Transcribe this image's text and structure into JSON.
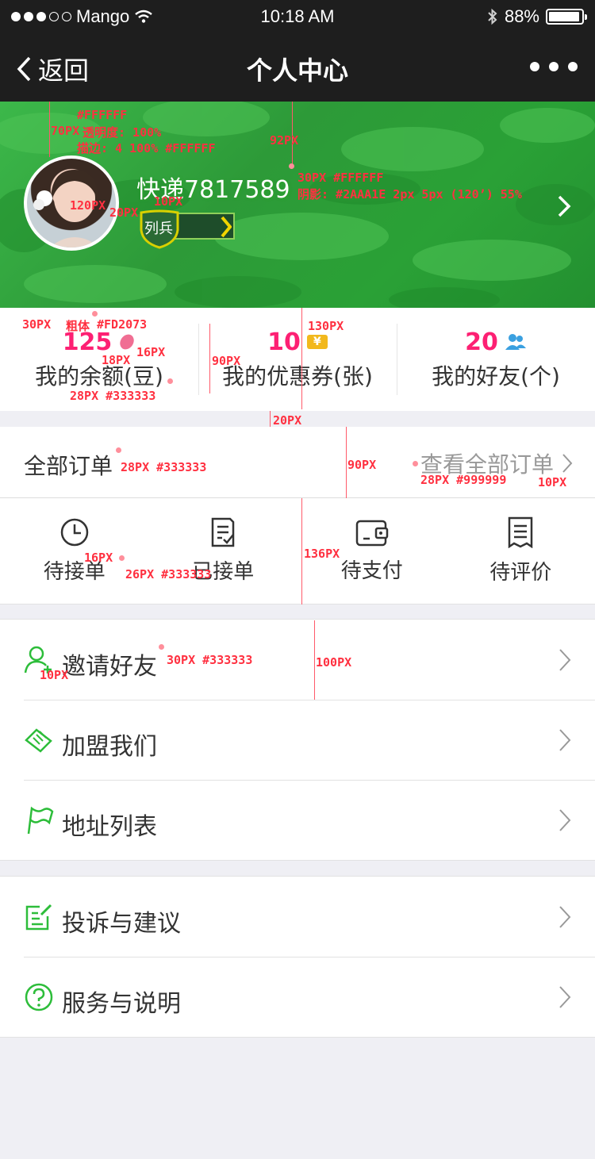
{
  "status_bar": {
    "carrier": "Mango",
    "time": "10:18 AM",
    "battery": "88%",
    "battery_level": 0.88
  },
  "nav": {
    "back_label": "返回",
    "title": "个人中心"
  },
  "profile": {
    "name": "快递7817589",
    "rank": "列兵"
  },
  "stats": [
    {
      "value": "125",
      "label": "我的余额(豆)",
      "icon": "bean-icon"
    },
    {
      "value": "10",
      "label": "我的优惠券(张)",
      "icon": "coupon-icon",
      "icon_text": "¥"
    },
    {
      "value": "20",
      "label": "我的好友(个)",
      "icon": "friends-icon"
    }
  ],
  "orders": {
    "title": "全部订单",
    "view_all": "查看全部订单",
    "items": [
      {
        "label": "待接单",
        "icon": "clock-icon"
      },
      {
        "label": "已接单",
        "icon": "checklist-icon"
      },
      {
        "label": "待支付",
        "icon": "wallet-icon"
      },
      {
        "label": "待评价",
        "icon": "receipt-icon"
      }
    ]
  },
  "menu_group_1": [
    {
      "label": "邀请好友",
      "icon": "invite-user-icon"
    },
    {
      "label": "加盟我们",
      "icon": "handshake-icon"
    },
    {
      "label": "地址列表",
      "icon": "flag-icon"
    }
  ],
  "menu_group_2": [
    {
      "label": "投诉与建议",
      "icon": "edit-icon"
    },
    {
      "label": "服务与说明",
      "icon": "help-icon"
    }
  ],
  "colors": {
    "accent_green": "#2dbd3a",
    "pink": "#fd2073",
    "dark_bar": "#1e1e1e",
    "friends_blue": "#3aa0e0",
    "coupon_yellow": "#f2b81c"
  },
  "annotations": {
    "a1": "#FFFFFF",
    "a2": "70PX",
    "a3": "透明度: 100%",
    "a4": "描边: 4 100% #FFFFFF",
    "a5": "92PX",
    "a6": "30PX #FFFFFF",
    "a7": "阴影: #2AAA1E 2px 5px (120’) 55%",
    "a8": "120PX",
    "a9": "20PX",
    "a10": "10PX",
    "a11": "30PX",
    "a12": "粗体",
    "a13": "#FD2073",
    "a14": "130PX",
    "a15": "18PX",
    "a16": "16PX",
    "a17": "90PX",
    "a18": "28PX #333333",
    "a19": "20PX",
    "a20": "28PX #333333",
    "a21": "90PX",
    "a22": "28PX #999999",
    "a23": "10PX",
    "a24": "16PX",
    "a25": "26PX #333333",
    "a26": "136PX",
    "a27": "30PX #333333",
    "a28": "100PX",
    "a29": "10PX"
  }
}
